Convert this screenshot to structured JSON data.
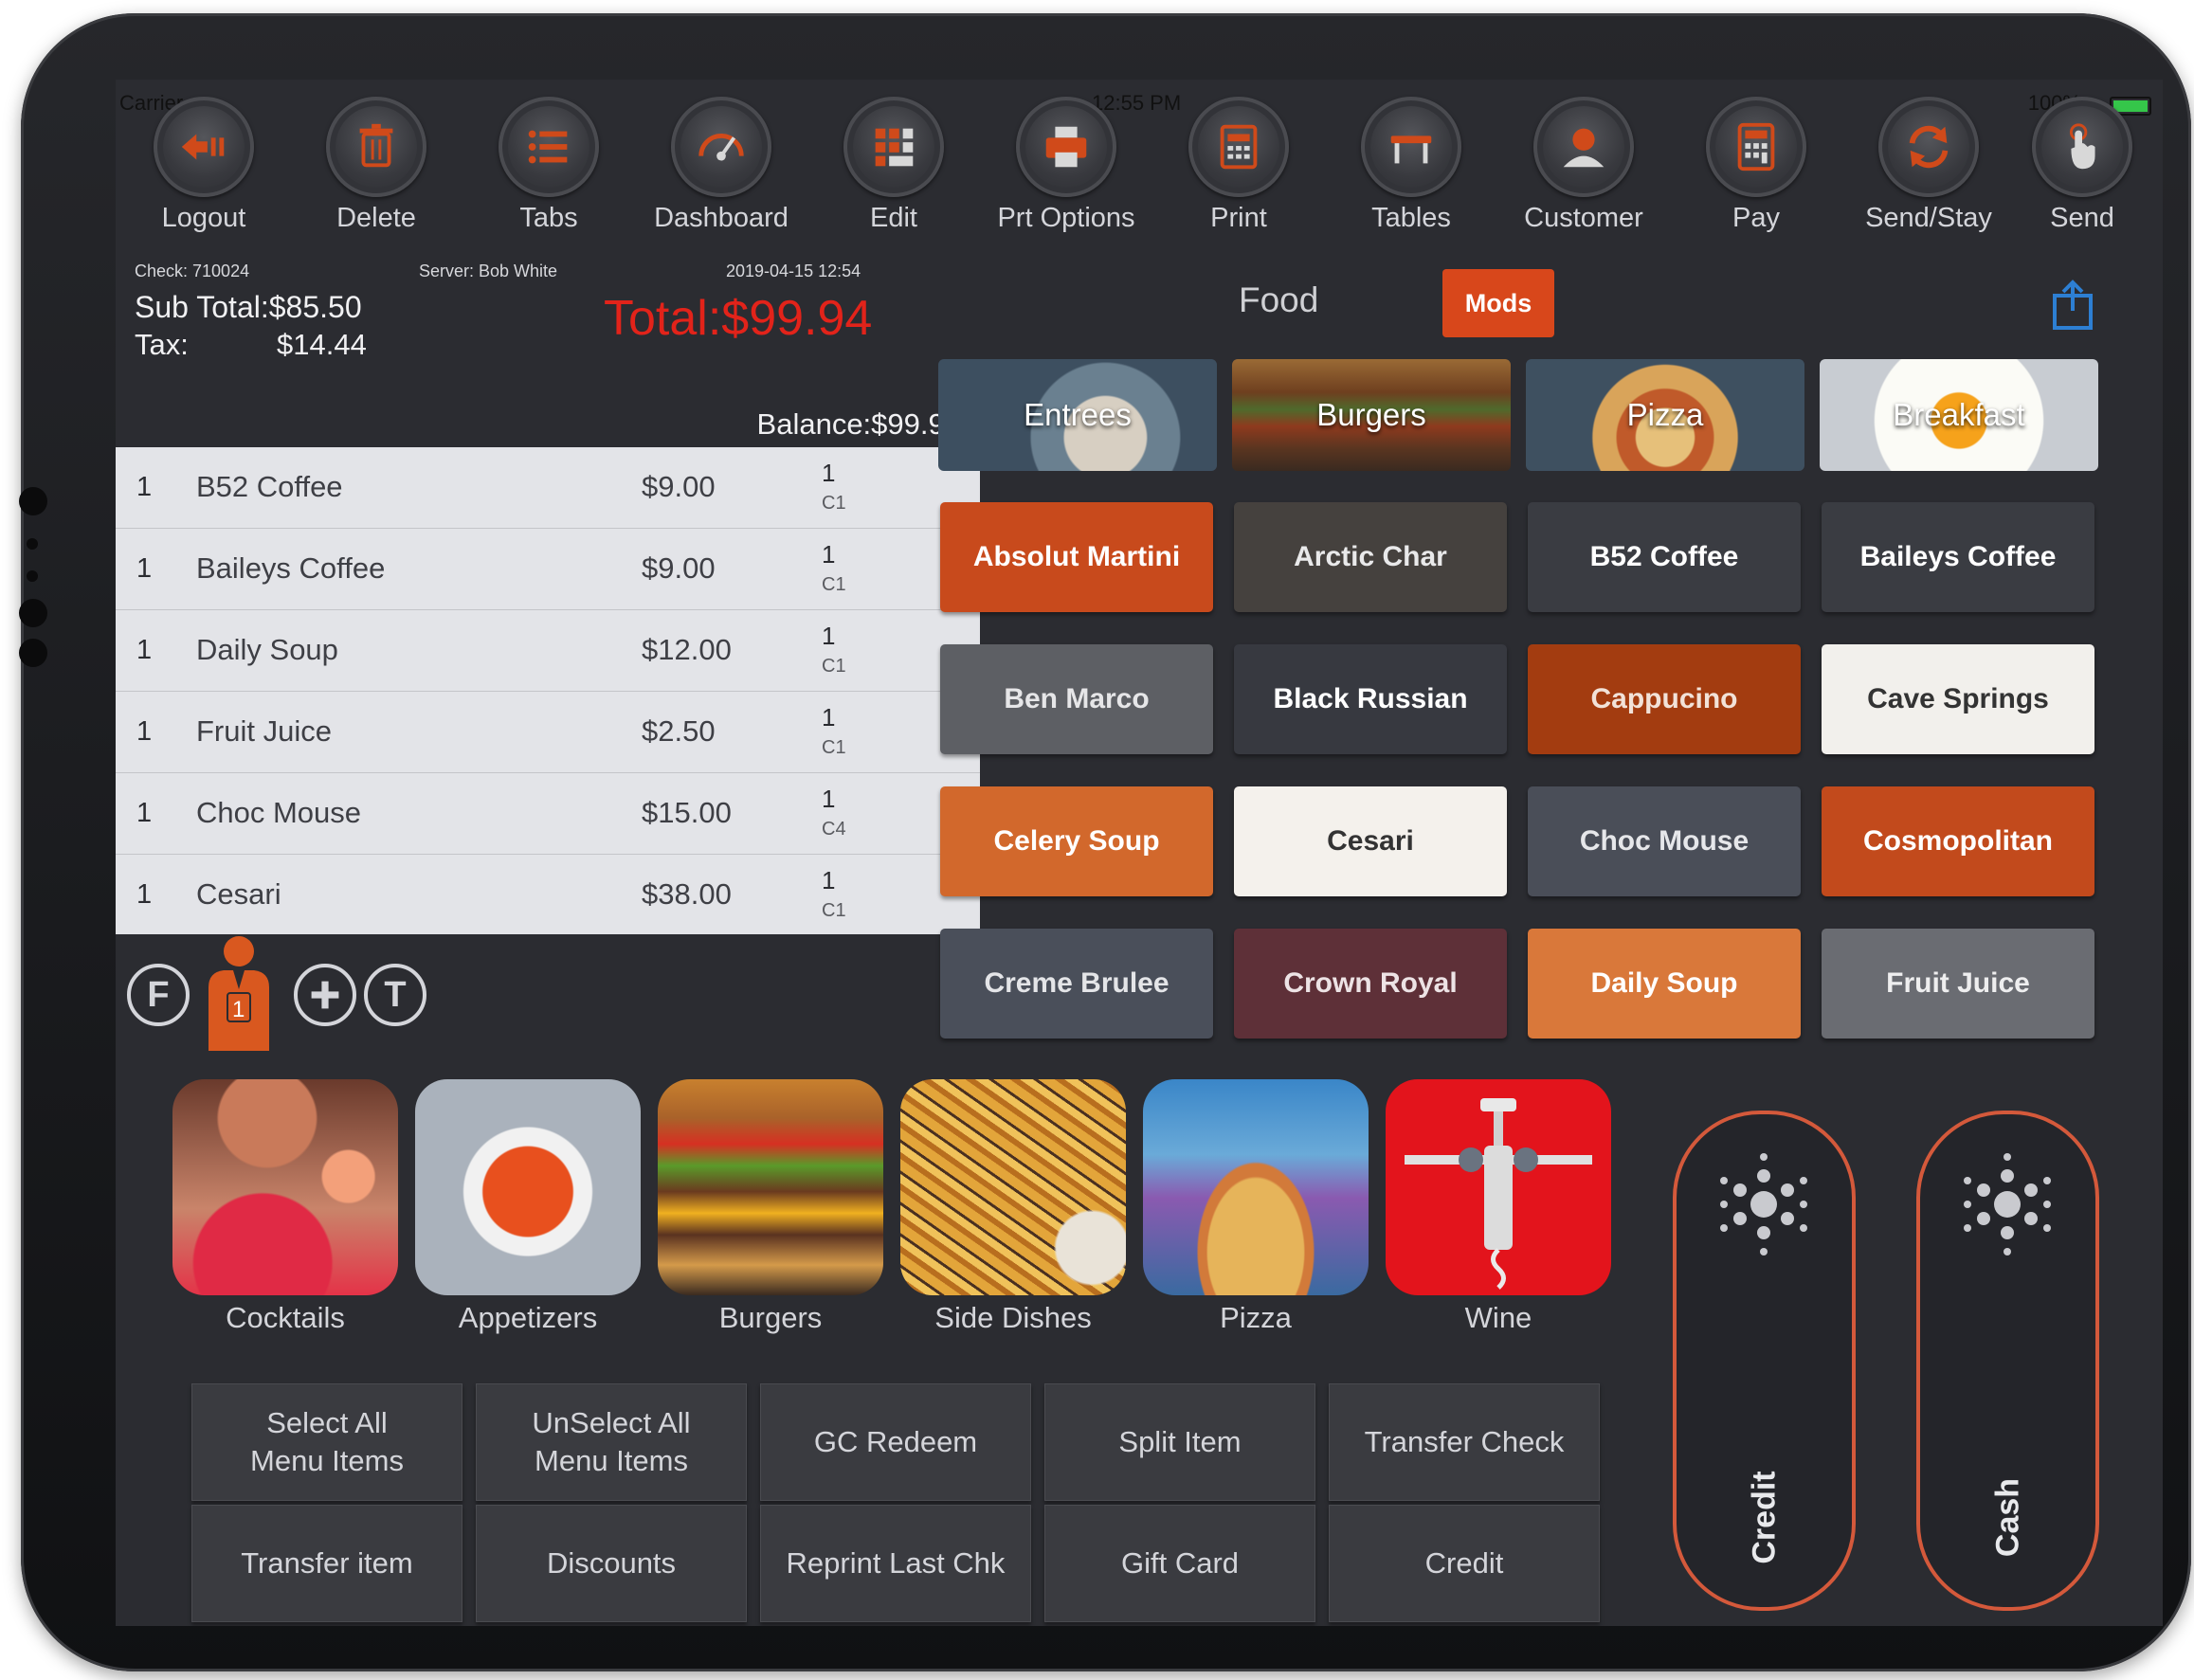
{
  "status": {
    "carrier": "Carrier",
    "time": "12:55 PM",
    "battery": "100%"
  },
  "toolbar": [
    {
      "label": "Logout",
      "icon": "logout-icon"
    },
    {
      "label": "Delete",
      "icon": "trash-icon"
    },
    {
      "label": "Tabs",
      "icon": "list-icon"
    },
    {
      "label": "Dashboard",
      "icon": "gauge-icon"
    },
    {
      "label": "Edit",
      "icon": "grid-edit-icon"
    },
    {
      "label": "Prt Options",
      "icon": "printer-icon"
    },
    {
      "label": "Print",
      "icon": "receipt-icon"
    },
    {
      "label": "Tables",
      "icon": "table-icon"
    },
    {
      "label": "Customer",
      "icon": "customer-icon"
    },
    {
      "label": "Pay",
      "icon": "calculator-icon"
    },
    {
      "label": "Send/Stay",
      "icon": "sync-icon"
    },
    {
      "label": "Send",
      "icon": "tap-icon"
    }
  ],
  "check": {
    "check_no": "Check: 710024",
    "server": "Server: Bob White",
    "datetime": "2019-04-15 12:54",
    "subtotal": "Sub Total:$85.50",
    "tax_label": "Tax:",
    "tax_value": "$14.44",
    "total": "Total:$99.94",
    "balance": "Balance:$99.94"
  },
  "order_items": [
    {
      "qty": "1",
      "name": "B52 Coffee",
      "price": "$9.00",
      "seat": "1",
      "course": "C1"
    },
    {
      "qty": "1",
      "name": "Baileys Coffee",
      "price": "$9.00",
      "seat": "1",
      "course": "C1"
    },
    {
      "qty": "1",
      "name": "Daily Soup",
      "price": "$12.00",
      "seat": "1",
      "course": "C1"
    },
    {
      "qty": "1",
      "name": "Fruit Juice",
      "price": "$2.50",
      "seat": "1",
      "course": "C1"
    },
    {
      "qty": "1",
      "name": "Choc Mouse",
      "price": "$15.00",
      "seat": "1",
      "course": "C4"
    },
    {
      "qty": "1",
      "name": "Cesari",
      "price": "$38.00",
      "seat": "1",
      "course": "C1"
    }
  ],
  "seat_controls": {
    "f": "F",
    "seat_number": "1",
    "t": "T"
  },
  "menu": {
    "food_label": "Food",
    "mods_label": "Mods",
    "categories": [
      "Entrees",
      "Burgers",
      "Pizza",
      "Breakfast"
    ],
    "items": [
      {
        "label": "Absolut Martini",
        "bg": "#c84a1c",
        "fg": "#ffffff"
      },
      {
        "label": "Arctic Char",
        "bg": "#45413e",
        "fg": "#e9e9ea"
      },
      {
        "label": "B52 Coffee",
        "bg": "#3a3c42",
        "fg": "#ffffff"
      },
      {
        "label": "Baileys Coffee",
        "bg": "#3a3c42",
        "fg": "#ffffff"
      },
      {
        "label": "Ben Marco",
        "bg": "#5d5f64",
        "fg": "#e6e6e8"
      },
      {
        "label": "Black Russian",
        "bg": "#373940",
        "fg": "#ffffff"
      },
      {
        "label": "Cappucino",
        "bg": "#a33c10",
        "fg": "#f2e2d8"
      },
      {
        "label": "Cave Springs",
        "bg": "#f2f0ec",
        "fg": "#333333"
      },
      {
        "label": "Celery Soup",
        "bg": "#d2682c",
        "fg": "#ffffff"
      },
      {
        "label": "Cesari",
        "bg": "#f4f1ec",
        "fg": "#333333"
      },
      {
        "label": "Choc Mouse",
        "bg": "#4a4e58",
        "fg": "#e6e7ea"
      },
      {
        "label": "Cosmopolitan",
        "bg": "#c24a1c",
        "fg": "#ffffff"
      },
      {
        "label": "Creme Brulee",
        "bg": "#4a4f5a",
        "fg": "#e4e5e8"
      },
      {
        "label": "Crown Royal",
        "bg": "#5e3038",
        "fg": "#ede3e5"
      },
      {
        "label": "Daily Soup",
        "bg": "#d9783a",
        "fg": "#ffffff"
      },
      {
        "label": "Fruit Juice",
        "bg": "#6a6c72",
        "fg": "#eeeeef"
      }
    ]
  },
  "big_categories": [
    "Cocktails",
    "Appetizers",
    "Burgers",
    "Side Dishes",
    "Pizza",
    "Wine"
  ],
  "actions": [
    {
      "line1": "Select All",
      "line2": "Menu Items"
    },
    {
      "line1": "UnSelect All",
      "line2": "Menu Items"
    },
    {
      "line1": "GC Redeem",
      "line2": ""
    },
    {
      "line1": "Split Item",
      "line2": ""
    },
    {
      "line1": "Transfer Check",
      "line2": ""
    },
    {
      "line1": "Transfer item",
      "line2": ""
    },
    {
      "line1": "Discounts",
      "line2": ""
    },
    {
      "line1": "Reprint Last Chk",
      "line2": ""
    },
    {
      "line1": "Gift Card",
      "line2": ""
    },
    {
      "line1": "Credit",
      "line2": ""
    }
  ],
  "payment": {
    "credit_label": "Credit",
    "cash_label": "Cash"
  },
  "colors": {
    "accent": "#d8471b",
    "total_red": "#e2231a",
    "pill_border": "#d4593b"
  }
}
